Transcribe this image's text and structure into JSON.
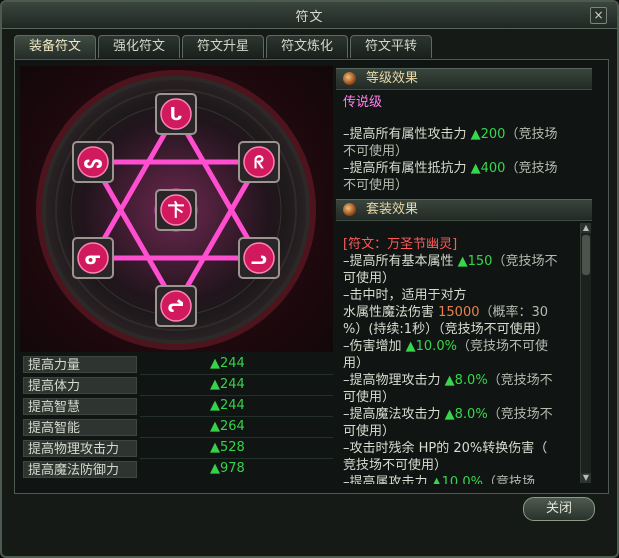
{
  "window": {
    "title": "符文",
    "close_label": "×"
  },
  "tabs": [
    "装备符文",
    "强化符文",
    "符文升星",
    "符文炼化",
    "符文平转"
  ],
  "runes": [
    "ᒐ",
    "ᖇ",
    "ᓗ",
    "ᖠ",
    "ᓂ",
    "ᔕ",
    "卞"
  ],
  "stats": [
    {
      "label": "提高力量",
      "value": "▲244"
    },
    {
      "label": "提高体力",
      "value": "▲244"
    },
    {
      "label": "提高智慧",
      "value": "▲244"
    },
    {
      "label": "提高智能",
      "value": "▲264"
    },
    {
      "label": "提高物理攻击力",
      "value": "▲528"
    },
    {
      "label": "提高魔法防御力",
      "value": "▲978"
    }
  ],
  "level_effect": {
    "header": "等级效果",
    "grade": "传说级",
    "line1_a": "–提高所有属性攻击力 ",
    "line1_b": "▲200",
    "line1_c": "（竞技场",
    "line1_d": "不可使用）",
    "line2_a": "–提高所有属性抵抗力 ",
    "line2_b": "▲400",
    "line2_c": "（竞技场",
    "line2_d": "不可使用）"
  },
  "set_effect": {
    "header": "套装效果",
    "set_name": "[符文：万圣节幽灵]",
    "lines": [
      [
        "–提高所有基本属性 ",
        "▲150",
        "（竞技场不"
      ],
      [
        "可使用）",
        "",
        ""
      ],
      [
        "–击中时，适用于对方",
        "",
        ""
      ],
      [
        " 水属性魔法伤害 ",
        "15000",
        "（概率：30"
      ],
      [
        "%）(持续:1秒）（竞技场不可使用）",
        "",
        ""
      ],
      [
        "–伤害增加 ",
        "▲10.0%",
        "（竞技场不可使"
      ],
      [
        "用）",
        "",
        ""
      ],
      [
        "–提高物理攻击力 ",
        "▲8.0%",
        "（竞技场不"
      ],
      [
        "可使用）",
        "",
        ""
      ],
      [
        "–提高魔法攻击力 ",
        "▲8.0%",
        "（竞技场不"
      ],
      [
        "可使用）",
        "",
        ""
      ],
      [
        "–攻击时残余 HP的 20%转换伤害（",
        "",
        ""
      ],
      [
        "竞技场不可使用）",
        "",
        ""
      ],
      [
        "–提高属攻击力 ",
        "▲10.0%",
        "（竞技场"
      ]
    ]
  },
  "close_button": "关闭"
}
